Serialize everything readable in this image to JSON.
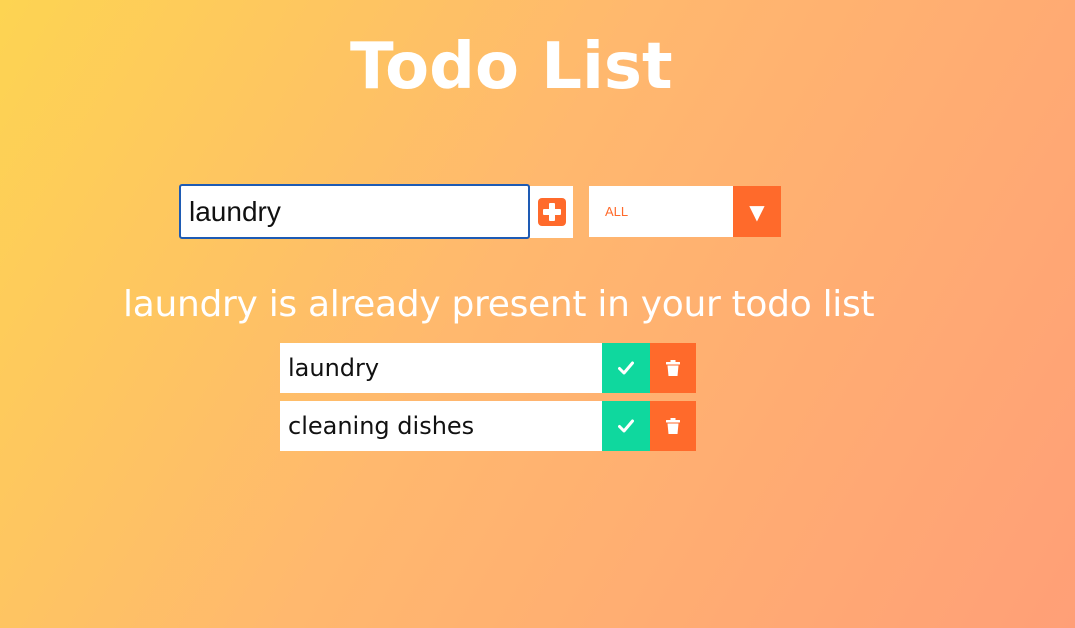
{
  "header": {
    "title": "Todo List"
  },
  "form": {
    "input_value": "laundry",
    "add_icon": "plus-square-icon",
    "filter": {
      "selected": "ALL",
      "arrow_icon": "caret-down-icon"
    }
  },
  "message": "laundry is already present in your todo list",
  "todos": [
    {
      "text": "laundry"
    },
    {
      "text": "cleaning dishes"
    }
  ],
  "colors": {
    "accent": "#ff6a2b",
    "complete": "#0fd89e",
    "gradient_start": "#fdd452",
    "gradient_end": "#ff9f77"
  }
}
